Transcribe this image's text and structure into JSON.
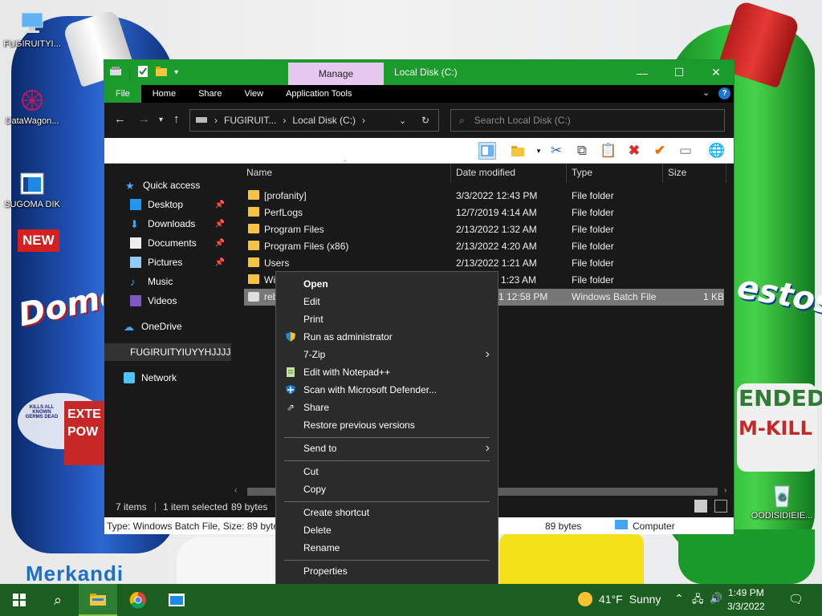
{
  "desktop": {
    "icons": [
      {
        "label": "FUGIRUITYI..."
      },
      {
        "label": "DataWagon..."
      },
      {
        "label": "SUGOMA DIK"
      },
      {
        "label": "OODISIDIEIE..."
      }
    ],
    "wallpaper": {
      "new_badge": "NEW",
      "brand_blue": "Domes",
      "brand_green": "estos",
      "blue_kills": "KILLS ALL KNOWN GERMS DEAD",
      "blue_extra": "EXTE POW",
      "green_extended": "ENDED",
      "green_kill": "M-KILL",
      "merkandi": "Merkandi"
    }
  },
  "window": {
    "title": "Local Disk (C:)",
    "manage_tab": "Manage",
    "ribbon_tabs": [
      "File",
      "Home",
      "Share",
      "View",
      "Application Tools"
    ],
    "address": {
      "segments": [
        "FUGIRUIT...",
        "Local Disk (C:)"
      ]
    },
    "search_placeholder": "Search Local Disk (C:)",
    "nav": {
      "quick_access": "Quick access",
      "desktop": "Desktop",
      "downloads": "Downloads",
      "documents": "Documents",
      "pictures": "Pictures",
      "music": "Music",
      "videos": "Videos",
      "onedrive": "OneDrive",
      "this_pc": "FUGIRUITYIUYYHJJJJJ",
      "network": "Network"
    },
    "columns": {
      "name": "Name",
      "date": "Date modified",
      "type": "Type",
      "size": "Size"
    },
    "files": [
      {
        "name": "[profanity]",
        "date": "3/3/2022 12:43 PM",
        "type": "File folder",
        "size": ""
      },
      {
        "name": "PerfLogs",
        "date": "12/7/2019 4:14 AM",
        "type": "File folder",
        "size": ""
      },
      {
        "name": "Program Files",
        "date": "2/13/2022 1:32 AM",
        "type": "File folder",
        "size": ""
      },
      {
        "name": "Program Files (x86)",
        "date": "2/13/2022 4:20 AM",
        "type": "File folder",
        "size": ""
      },
      {
        "name": "Users",
        "date": "2/13/2022 1:21 AM",
        "type": "File folder",
        "size": ""
      },
      {
        "name": "Wi",
        "date": "1:23 AM",
        "type": "File folder",
        "size": ""
      },
      {
        "name": "reb",
        "date": "1 12:58 PM",
        "type": "Windows Batch File",
        "size": "1 KB"
      }
    ],
    "status": {
      "items": "7 items",
      "selected": "1 item selected",
      "bytes": "89 bytes"
    },
    "details": {
      "info": "Type: Windows Batch File, Size: 89 bytes,",
      "size": "89 bytes",
      "location": "Computer"
    }
  },
  "context_menu": {
    "items": [
      {
        "label": "Open",
        "icon": ""
      },
      {
        "label": "Edit",
        "icon": ""
      },
      {
        "label": "Print",
        "icon": ""
      },
      {
        "label": "Run as administrator",
        "icon": "uac-shield-icon"
      },
      {
        "label": "7-Zip",
        "icon": "",
        "submenu": true
      },
      {
        "label": "Edit with Notepad++",
        "icon": "notepadpp-icon"
      },
      {
        "label": "Scan with Microsoft Defender...",
        "icon": "defender-icon"
      },
      {
        "label": "Share",
        "icon": "share-icon"
      },
      {
        "label": "Restore previous versions",
        "icon": ""
      },
      {
        "label": "Send to",
        "icon": "",
        "submenu": true
      },
      {
        "label": "Cut",
        "icon": ""
      },
      {
        "label": "Copy",
        "icon": ""
      },
      {
        "label": "Create shortcut",
        "icon": ""
      },
      {
        "label": "Delete",
        "icon": ""
      },
      {
        "label": "Rename",
        "icon": ""
      },
      {
        "label": "Properties",
        "icon": ""
      }
    ]
  },
  "taskbar": {
    "weather": {
      "temp": "41°F",
      "condition": "Sunny"
    },
    "clock": {
      "time": "1:49 PM",
      "date": "3/3/2022"
    }
  },
  "colors": {
    "accent": "#1c9b2d",
    "taskbar": "#1b5e20",
    "manage_tab": "#e6c8f0"
  }
}
